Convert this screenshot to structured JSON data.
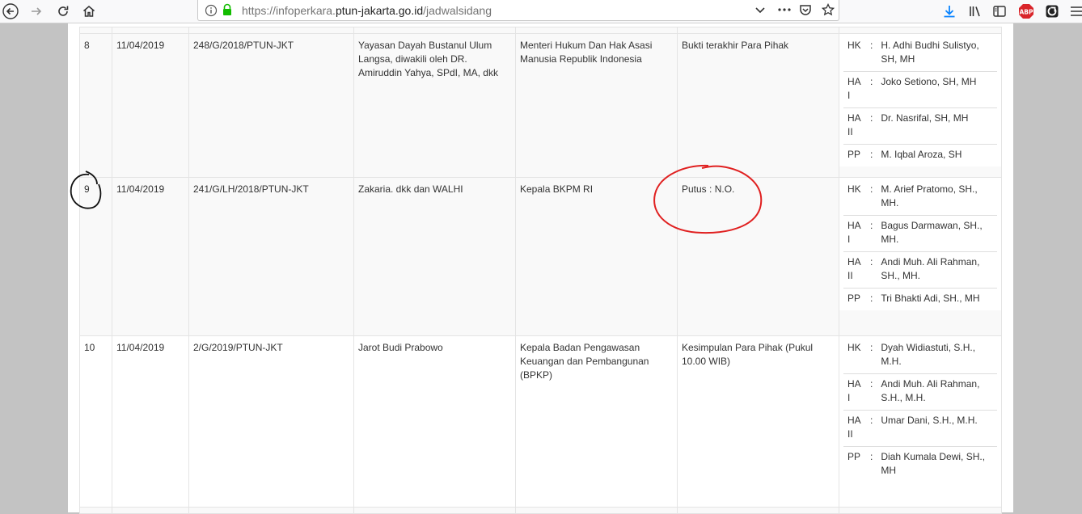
{
  "browser": {
    "url_prefix": "https://infoperkara.",
    "url_host": "ptun-jakarta.go.id",
    "url_path": "/jadwalsidang",
    "abp_label": "ABP"
  },
  "rows": [
    {
      "no": "8",
      "date": "11/04/2019",
      "case_no": "248/G/2018/PTUN-JKT",
      "plaintiff": "Yayasan Dayah Bustanul Ulum Langsa, diwakili oleh DR. Amiruddin Yahya, SPdI, MA, dkk",
      "defendant": "Menteri Hukum Dan Hak Asasi Manusia Republik Indonesia",
      "agenda": "Bukti terakhir Para Pihak",
      "judges": [
        {
          "role": "HK",
          "sep": ":",
          "name": "H. Adhi Budhi Sulistyo, SH, MH"
        },
        {
          "role": "HA I",
          "sep": ":",
          "name": "Joko Setiono, SH, MH"
        },
        {
          "role": "HA II",
          "sep": ":",
          "name": "Dr. Nasrifal, SH, MH"
        },
        {
          "role": "PP",
          "sep": ":",
          "name": "M. Iqbal Aroza, SH"
        }
      ]
    },
    {
      "no": "9",
      "date": "11/04/2019",
      "case_no": "241/G/LH/2018/PTUN-JKT",
      "plaintiff": "Zakaria. dkk dan WALHI",
      "defendant": "Kepala BKPM RI",
      "agenda": "Putus : N.O.",
      "judges": [
        {
          "role": "HK",
          "sep": ":",
          "name": "M. Arief Pratomo, SH., MH."
        },
        {
          "role": "HA I",
          "sep": ":",
          "name": "Bagus Darmawan, SH., MH."
        },
        {
          "role": "HA II",
          "sep": ":",
          "name": "Andi Muh. Ali Rahman, SH., MH."
        },
        {
          "role": "PP",
          "sep": ":",
          "name": "Tri Bhakti Adi, SH., MH"
        }
      ]
    },
    {
      "no": "10",
      "date": "11/04/2019",
      "case_no": "2/G/2019/PTUN-JKT",
      "plaintiff": "Jarot Budi Prabowo",
      "defendant": "Kepala Badan Pengawasan Keuangan dan Pembangunan (BPKP)",
      "agenda": "Kesimpulan Para Pihak (Pukul 10.00 WIB)",
      "judges": [
        {
          "role": "HK",
          "sep": ":",
          "name": "Dyah Widiastuti, S.H., M.H."
        },
        {
          "role": "HA I",
          "sep": ":",
          "name": "Andi Muh. Ali Rahman, S.H., M.H."
        },
        {
          "role": "HA II",
          "sep": ":",
          "name": "Umar Dani, S.H., M.H."
        },
        {
          "role": "PP",
          "sep": ":",
          "name": "Diah Kumala Dewi, SH., MH"
        }
      ]
    }
  ],
  "colors": {
    "annotation_red": "#e02020",
    "annotation_black": "#111111"
  }
}
